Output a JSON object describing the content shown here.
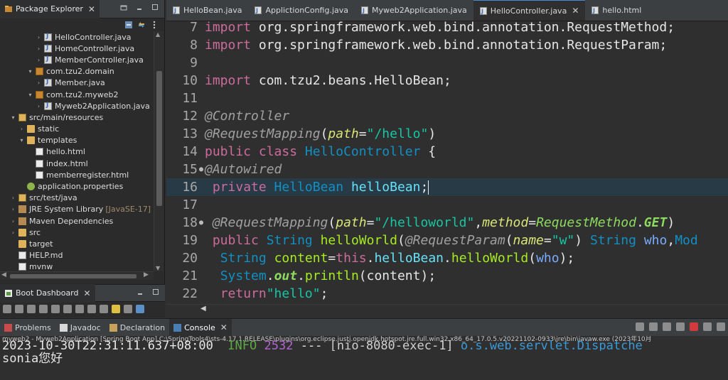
{
  "explorer": {
    "tab_label": "Package Explorer",
    "close_symbol": "✕",
    "tree": [
      {
        "label": "HelloController.java",
        "indent": 4,
        "twisty": ">",
        "icon": "java-file-icon"
      },
      {
        "label": "HomeController.java",
        "indent": 4,
        "twisty": ">",
        "icon": "java-file-icon"
      },
      {
        "label": "MemberController.java",
        "indent": 4,
        "twisty": ">",
        "icon": "java-file-icon"
      },
      {
        "label": "com.tzu2.domain",
        "indent": 3,
        "twisty": "v",
        "icon": "package-icon"
      },
      {
        "label": "Member.java",
        "indent": 4,
        "twisty": ">",
        "icon": "java-file-icon"
      },
      {
        "label": "com.tzu2.myweb2",
        "indent": 3,
        "twisty": "v",
        "icon": "package-icon"
      },
      {
        "label": "Myweb2Application.java",
        "indent": 4,
        "twisty": ">",
        "icon": "java-file-icon"
      },
      {
        "label": "src/main/resources",
        "indent": 1,
        "twisty": "v",
        "icon": "source-folder-icon"
      },
      {
        "label": "static",
        "indent": 2,
        "twisty": ">",
        "icon": "folder-icon"
      },
      {
        "label": "templates",
        "indent": 2,
        "twisty": "v",
        "icon": "folder-icon"
      },
      {
        "label": "hello.html",
        "indent": 3,
        "twisty": "",
        "icon": "html-file-icon"
      },
      {
        "label": "index.html",
        "indent": 3,
        "twisty": "",
        "icon": "html-file-icon"
      },
      {
        "label": "memberregister.html",
        "indent": 3,
        "twisty": "",
        "icon": "html-file-icon"
      },
      {
        "label": "application.properties",
        "indent": 2,
        "twisty": "",
        "icon": "properties-file-icon"
      },
      {
        "label": "src/test/java",
        "indent": 1,
        "twisty": ">",
        "icon": "source-folder-icon"
      },
      {
        "label": "JRE System Library",
        "suffix": "[JavaSE-17]",
        "indent": 1,
        "twisty": ">",
        "icon": "library-icon"
      },
      {
        "label": "Maven Dependencies",
        "indent": 1,
        "twisty": ">",
        "icon": "library-icon"
      },
      {
        "label": "src",
        "indent": 1,
        "twisty": ">",
        "icon": "folder-icon"
      },
      {
        "label": "target",
        "indent": 1,
        "twisty": "",
        "icon": "folder-icon"
      },
      {
        "label": "HELP.md",
        "indent": 1,
        "twisty": "",
        "icon": "markdown-file-icon"
      },
      {
        "label": "mvnw",
        "indent": 1,
        "twisty": "",
        "icon": "file-icon"
      }
    ]
  },
  "boot": {
    "tab_label": "Boot Dashboard",
    "close_symbol": "✕"
  },
  "editor": {
    "tabs": [
      {
        "label": "HelloBean.java",
        "active": false,
        "closable": false
      },
      {
        "label": "ApplictionConfig.java",
        "active": false,
        "closable": false
      },
      {
        "label": "Myweb2Application.java",
        "active": false,
        "closable": false
      },
      {
        "label": "HelloController.java",
        "active": true,
        "closable": true
      },
      {
        "label": "hello.html",
        "active": false,
        "closable": false
      }
    ],
    "close_symbol": "✕",
    "lines": [
      {
        "num": "7",
        "mark": "",
        "tokens": [
          [
            "kw",
            "import"
          ],
          [
            "plain",
            " org.springframework.web.bind.annotation.RequestMethod;"
          ]
        ]
      },
      {
        "num": "8",
        "mark": "",
        "tokens": [
          [
            "kw",
            "import"
          ],
          [
            "plain",
            " org.springframework.web.bind.annotation.RequestParam;"
          ]
        ]
      },
      {
        "num": "9",
        "mark": "",
        "tokens": []
      },
      {
        "num": "10",
        "mark": "",
        "tokens": [
          [
            "kw",
            "import"
          ],
          [
            "plain",
            " com.tzu2.beans.HelloBean;"
          ]
        ]
      },
      {
        "num": "11",
        "mark": "",
        "tokens": []
      },
      {
        "num": "12",
        "mark": "",
        "tokens": [
          [
            "ann",
            "@Controller"
          ]
        ]
      },
      {
        "num": "13",
        "mark": "",
        "tokens": [
          [
            "ann",
            "@RequestMapping"
          ],
          [
            "plain",
            "("
          ],
          [
            "attr",
            "path"
          ],
          [
            "plain",
            "="
          ],
          [
            "str",
            "\"/hello\""
          ],
          [
            "plain",
            ")"
          ]
        ]
      },
      {
        "num": "14",
        "mark": "",
        "tokens": [
          [
            "kw",
            "public"
          ],
          [
            "plain",
            " "
          ],
          [
            "kw",
            "class"
          ],
          [
            "plain",
            " "
          ],
          [
            "type",
            "HelloController"
          ],
          [
            "plain",
            " {"
          ]
        ]
      },
      {
        "num": "15",
        "mark": "●",
        "tokens": [
          [
            "ann",
            "@Autowired"
          ]
        ]
      },
      {
        "num": "16",
        "mark": "",
        "cursor": true,
        "tokens": [
          [
            "plain",
            " "
          ],
          [
            "kw",
            "private"
          ],
          [
            "plain",
            " "
          ],
          [
            "type",
            "HelloBean"
          ],
          [
            "plain",
            " "
          ],
          [
            "field",
            "helloBean"
          ],
          [
            "plain",
            ";"
          ]
        ]
      },
      {
        "num": "17",
        "mark": "",
        "tokens": []
      },
      {
        "num": "18",
        "mark": "●",
        "tokens": [
          [
            "plain",
            " "
          ],
          [
            "ann",
            "@RequestMapping"
          ],
          [
            "plain",
            "("
          ],
          [
            "attr",
            "path"
          ],
          [
            "plain",
            "="
          ],
          [
            "str",
            "\"/helloworld\""
          ],
          [
            "plain",
            ","
          ],
          [
            "attr",
            "method"
          ],
          [
            "plain",
            "="
          ],
          [
            "const",
            "RequestMethod"
          ],
          [
            "plain",
            "."
          ],
          [
            "sfield",
            "GET"
          ],
          [
            "plain",
            ")"
          ]
        ]
      },
      {
        "num": "19",
        "mark": "",
        "tokens": [
          [
            "plain",
            " "
          ],
          [
            "kw",
            "public"
          ],
          [
            "plain",
            " "
          ],
          [
            "type",
            "String"
          ],
          [
            "plain",
            " "
          ],
          [
            "method",
            "helloWorld"
          ],
          [
            "plain",
            "("
          ],
          [
            "ann",
            "@RequestParam"
          ],
          [
            "plain",
            "("
          ],
          [
            "attr",
            "name"
          ],
          [
            "plain",
            "="
          ],
          [
            "str",
            "\"w\""
          ],
          [
            "plain",
            ") "
          ],
          [
            "type",
            "String"
          ],
          [
            "plain",
            " "
          ],
          [
            "param",
            "who"
          ],
          [
            "plain",
            ","
          ],
          [
            "type",
            "Mod"
          ]
        ]
      },
      {
        "num": "20",
        "mark": "",
        "tokens": [
          [
            "plain",
            "  "
          ],
          [
            "type",
            "String"
          ],
          [
            "plain",
            " "
          ],
          [
            "method",
            "content"
          ],
          [
            "plain",
            "="
          ],
          [
            "kw",
            "this"
          ],
          [
            "plain",
            "."
          ],
          [
            "field",
            "helloBean"
          ],
          [
            "plain",
            "."
          ],
          [
            "method",
            "helloWorld"
          ],
          [
            "plain",
            "("
          ],
          [
            "param",
            "who"
          ],
          [
            "plain",
            ");"
          ]
        ]
      },
      {
        "num": "21",
        "mark": "",
        "tokens": [
          [
            "plain",
            "  "
          ],
          [
            "type",
            "System"
          ],
          [
            "plain",
            "."
          ],
          [
            "sfield",
            "out"
          ],
          [
            "plain",
            "."
          ],
          [
            "method",
            "println"
          ],
          [
            "plain",
            "(content);"
          ]
        ]
      },
      {
        "num": "22",
        "mark": "",
        "tokens": [
          [
            "plain",
            "  "
          ],
          [
            "kw",
            "return"
          ],
          [
            "str",
            "\"hello\""
          ],
          [
            "plain",
            ";"
          ]
        ]
      }
    ]
  },
  "bottom": {
    "tabs": [
      {
        "label": "Problems",
        "active": false,
        "icon": "problems-icon"
      },
      {
        "label": "Javadoc",
        "active": false,
        "icon": "javadoc-icon"
      },
      {
        "label": "Declaration",
        "active": false,
        "icon": "declaration-icon"
      },
      {
        "label": "Console",
        "active": true,
        "icon": "console-icon"
      }
    ],
    "close_symbol": "✕",
    "console_description": "myweb2 - Myweb2Application [Spring Boot App] C:\\SpringTools4\\sts-4.17.1.RELEASE\\plugins\\org.eclipse.justj.openjdk.hotspot.jre.full.win32.x86_64_17.0.5.v20221102-0933\\jre\\bin\\javaw.exe  (2023年10月",
    "log": {
      "timestamp": "2023-10-30T22:31:11.637+08:00",
      "level": "INFO",
      "pid": "2532",
      "sep": "---",
      "thread": "[nio-8080-exec-1]",
      "logger": "o.s.web.servlet.Dispatche"
    },
    "output_line": "sonia您好"
  }
}
